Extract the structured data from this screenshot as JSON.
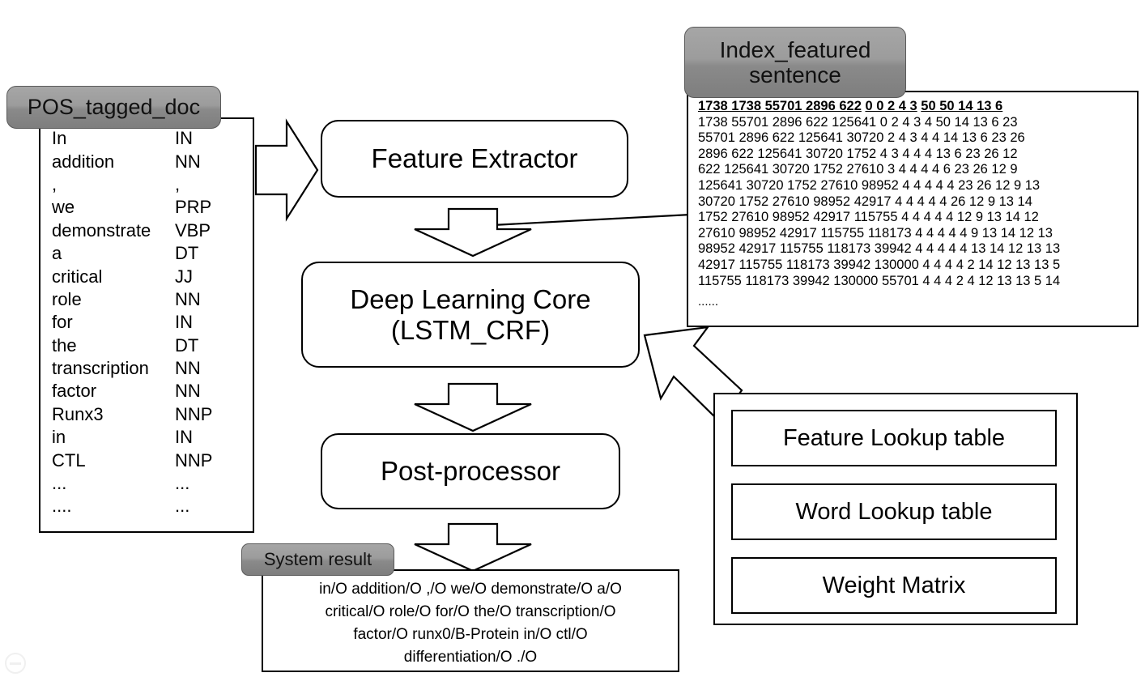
{
  "labels": {
    "pos_tagged_doc": "POS_tagged_doc",
    "index_featured_sentence": "Index_featured\nsentence",
    "index_featured_sentence_line1": "Index_featured",
    "index_featured_sentence_line2": "sentence",
    "system_result": "System result"
  },
  "pos_doc": {
    "rows": [
      {
        "word": "In",
        "tag": "IN"
      },
      {
        "word": "addition",
        "tag": "NN"
      },
      {
        "word": ",",
        "tag": ","
      },
      {
        "word": "we",
        "tag": "PRP"
      },
      {
        "word": "demonstrate",
        "tag": "VBP"
      },
      {
        "word": "a",
        "tag": "DT"
      },
      {
        "word": "critical",
        "tag": "JJ"
      },
      {
        "word": "role",
        "tag": "NN"
      },
      {
        "word": "for",
        "tag": "IN"
      },
      {
        "word": "the",
        "tag": "DT"
      },
      {
        "word": "transcription",
        "tag": "NN"
      },
      {
        "word": "factor",
        "tag": "NN"
      },
      {
        "word": "Runx3",
        "tag": "NNP"
      },
      {
        "word": "in",
        "tag": "IN"
      },
      {
        "word": "CTL",
        "tag": "NNP"
      },
      {
        "word": "...",
        "tag": "..."
      },
      {
        "word": "....",
        "tag": "..."
      }
    ]
  },
  "index_featured": {
    "header_groups": [
      "1738 1738 55701 2896 622",
      "0 0 2 4 3",
      "50 50 14 13 6"
    ],
    "lines": [
      "1738 55701 2896 622 125641 0 2 4 3 4 50 14 13 6 23",
      "55701 2896 622 125641 30720 2 4 3 4 4 14 13 6 23 26",
      "2896 622 125641 30720 1752 4 3 4 4 4 13 6 23 26 12",
      "622 125641 30720 1752 27610 3 4 4 4 4 6 23 26 12 9",
      "125641 30720 1752 27610 98952 4 4 4 4 4 23 26 12 9 13",
      "30720 1752 27610 98952 42917 4 4 4 4 4 26 12 9 13 14",
      "1752 27610 98952 42917 115755 4 4 4 4 4 12 9 13 14 12",
      "27610 98952 42917 115755 118173 4 4 4 4 4 9 13 14 12 13",
      "98952 42917 115755 118173 39942 4 4 4 4 4 13 14 12 13 13",
      "42917 115755 118173 39942 130000 4 4 4 4 2 14 12 13 13 5",
      "115755 118173 39942 130000 55701 4 4 4 2 4 12 13 13 5 14"
    ],
    "ellipsis": "......"
  },
  "pipeline": {
    "feature_extractor": "Feature Extractor",
    "deep_learning_core_line1": "Deep Learning Core",
    "deep_learning_core_line2": "(LSTM_CRF)",
    "post_processor": "Post-processor"
  },
  "lookup_tables": {
    "items": [
      {
        "label": "Feature Lookup table"
      },
      {
        "label": "Word Lookup table"
      },
      {
        "label": "Weight Matrix"
      }
    ]
  },
  "system_result": {
    "lines": [
      "in/O addition/O ,/O we/O demonstrate/O a/O",
      "critical/O role/O for/O the/O transcription/O",
      "factor/O runx0/B-Protein in/O ctl/O",
      "differentiation/O ./O"
    ]
  },
  "colors": {
    "pill_top": "#a6a6a6",
    "pill_bottom": "#7e7e7e",
    "pill_border": "#5a5a5a",
    "outline": "#000000",
    "background": "#ffffff"
  }
}
